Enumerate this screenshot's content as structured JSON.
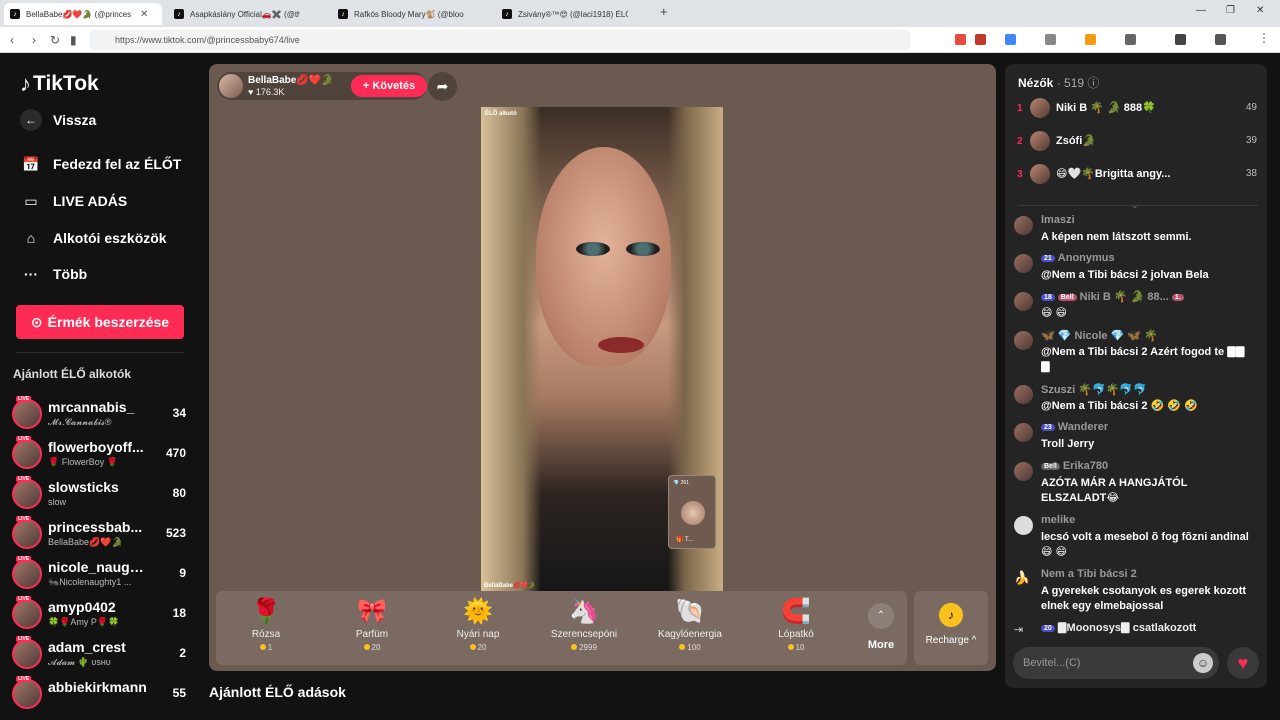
{
  "browser": {
    "tabs": [
      {
        "title": "BellaBabe💋❤️🐊 (@princes"
      },
      {
        "title": "Asapkáslány Official🚗✖️ (@theras"
      },
      {
        "title": "Rafkós Bloody Mary🐒 (@bloodymai"
      },
      {
        "title": "Zsivány®™😍 (@laci1918) ÉLŐ adás"
      }
    ],
    "url": "https://www.tiktok.com/@princessbaby674/live"
  },
  "sidebar": {
    "brand": "TikTok",
    "back": "Vissza",
    "nav": [
      {
        "label": "Fedezd fel az ÉLŐT"
      },
      {
        "label": "LIVE ADÁS"
      },
      {
        "label": "Alkotói eszközök"
      },
      {
        "label": "Több"
      }
    ],
    "coins_button": "Érmék beszerzése",
    "suggested_title": "Ajánlott ÉLŐ alkotók",
    "live_tag": "LIVE",
    "creators": [
      {
        "name": "mrcannabis_",
        "sub": "𝓜𝓻.𝓒𝓪𝓷𝓷𝓪𝓫𝓲𝓼®",
        "count": "34"
      },
      {
        "name": "flowerboyoff...",
        "sub": "🌹 FlowerBoy 🌹",
        "count": "470"
      },
      {
        "name": "slowsticks",
        "sub": "slow",
        "count": "80"
      },
      {
        "name": "princessbab...",
        "sub": "BellaBabe💋❤️🐊",
        "count": "523"
      },
      {
        "name": "nicole_naugh...",
        "sub": "🐜Nicolenaughty1 ...",
        "count": "9"
      },
      {
        "name": "amyp0402",
        "sub": "🍀🌹Amy P🌹🍀",
        "count": "18"
      },
      {
        "name": "adam_crest",
        "sub": "𝓐𝓭𝓪𝓶 🌵 ᴜsʜᴜ",
        "count": "2"
      },
      {
        "name": "abbiekirkmann",
        "sub": "",
        "count": "55"
      }
    ]
  },
  "stream": {
    "host_name": "BellaBabe💋❤️🐊",
    "likes": "♥ 176.3K",
    "follow": "+ Követés",
    "caption_top": "ÉLŐ alkotó",
    "caption_bottom": "BellaBabe💋❤️🐊",
    "pip_count": "💎 261",
    "pip_name": "🎁 T...",
    "gifts": [
      {
        "name": "Rózsa",
        "price": "1",
        "icon": "🌹"
      },
      {
        "name": "Parfüm",
        "price": "20",
        "icon": "🎀"
      },
      {
        "name": "Nyári nap",
        "price": "20",
        "icon": "🌞"
      },
      {
        "name": "Szerencsepóni",
        "price": "2999",
        "icon": "🦄"
      },
      {
        "name": "Kagylóenergia",
        "price": "100",
        "icon": "🐚"
      },
      {
        "name": "Lópatkó",
        "price": "10",
        "icon": "🧲"
      }
    ],
    "more": "More",
    "recharge": "Recharge ^",
    "recommended": "Ajánlott ÉLŐ adások"
  },
  "viewers": {
    "title": "Nézők",
    "count": "· 519",
    "top": [
      {
        "rank": "1",
        "name": "Niki B 🌴 🐊 888🍀",
        "score": "49"
      },
      {
        "rank": "2",
        "name": "Zsófi🐊",
        "score": "39"
      },
      {
        "rank": "3",
        "name": "😄🤍🌴Brigitta angy...",
        "score": "38"
      }
    ]
  },
  "chat": [
    {
      "user": "lmaszi",
      "badges": [],
      "text": "A képen nem látszott semmi."
    },
    {
      "user": "Anonymus",
      "badges": [
        "21"
      ],
      "text": "@Nem a Tibi bácsi 2 jolvan Bela"
    },
    {
      "user": "Niki B 🌴 🐊 88...",
      "badges": [
        "18",
        "Bell",
        "1."
      ],
      "text": "😄 😄"
    },
    {
      "user": "🦋 💎 Nicole 💎 🦋 🌴",
      "badges": [],
      "text": "@Nem a Tibi bácsi 2 Azért fogod te 🀫🀫🀫"
    },
    {
      "user": "Szuszi 🌴🐬🌴🐬🐬",
      "badges": [],
      "text": "@Nem a Tibi bácsi 2 🤣 🤣 🤣"
    },
    {
      "user": "Wanderer",
      "badges": [
        "23"
      ],
      "text": "Troll Jerry"
    },
    {
      "user": "Erika780",
      "badges": [
        "Bell"
      ],
      "text": "AZÓTA MÁR A HANGJÁTÓL ELSZALADT😂"
    },
    {
      "user": "melike",
      "badges": [],
      "text": "lecsó volt a mesebol õ fog fõzni andinal 😄 😄"
    },
    {
      "user": "Nem a Tibi bácsi 2",
      "badges": [],
      "text": "A gyerekek csotanyok es egerek kozott elnek egy elmebajossal"
    },
    {
      "user": "🀫Moonosys🀫",
      "badges": [
        "20"
      ],
      "text": "csatlakozott"
    }
  ],
  "input_placeholder": "Bevitel...(C)"
}
